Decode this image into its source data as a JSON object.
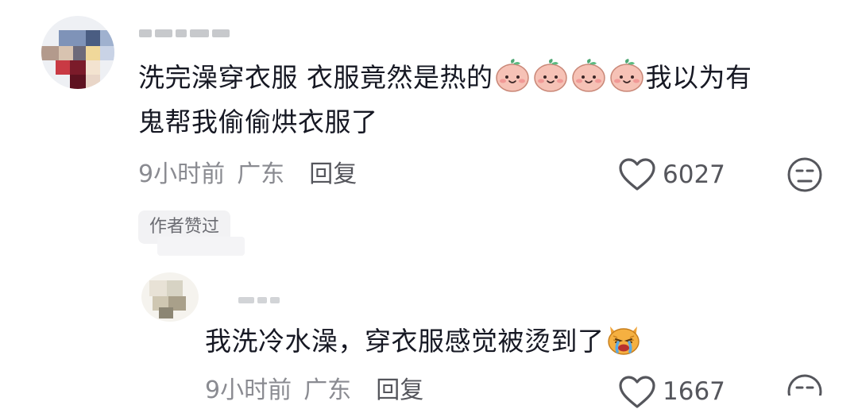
{
  "comment": {
    "username": "",
    "text_line1_a": "洗完澡穿衣服 衣服竟然是热的",
    "text_line1_b": "我以为有",
    "text_line2": "鬼帮我偷偷烘衣服了",
    "emoji_icon": "peach-smile-emoji",
    "emoji_count": 4,
    "time": "9小时前",
    "location": "广东",
    "reply_label": "回复",
    "likes": "6027",
    "author_liked_badge": "作者赞过"
  },
  "reply": {
    "username": "",
    "text": "我洗冷水澡，穿衣服感觉被烫到了",
    "emoji_icon": "crying-cat-emoji",
    "time": "9小时前",
    "location": "广东",
    "reply_label": "回复",
    "likes": "1667"
  },
  "colors": {
    "text": "#161823",
    "meta": "#8a8b91",
    "icon": "#55565c",
    "badge_bg": "#f2f2f4"
  }
}
